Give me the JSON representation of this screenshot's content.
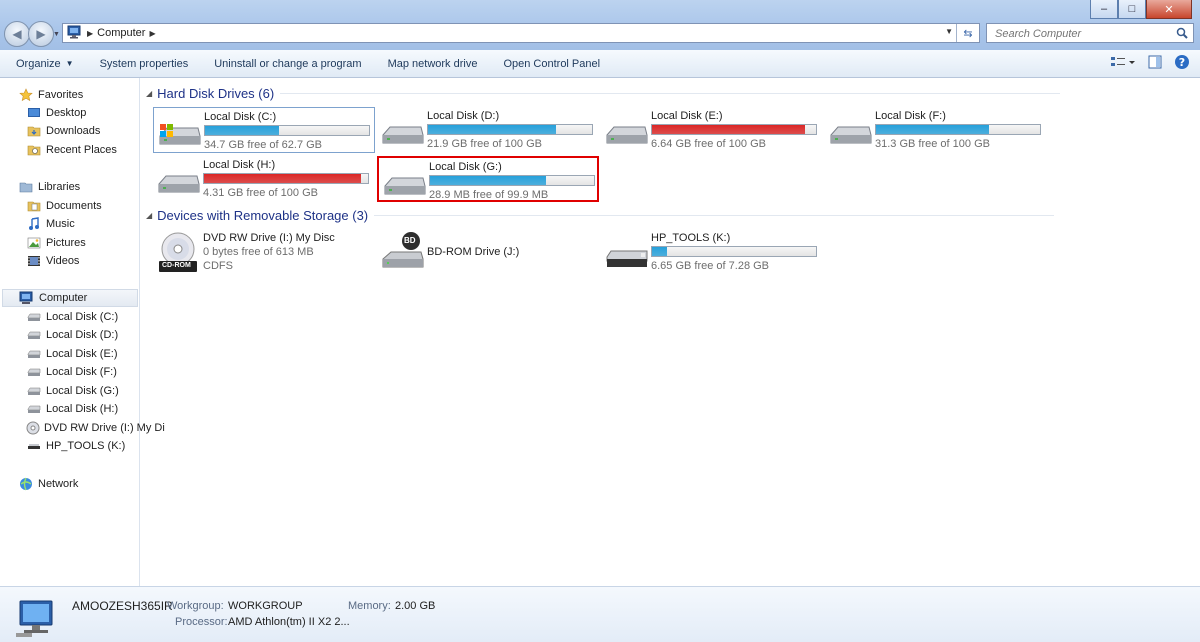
{
  "window": {
    "minimize": "–",
    "maximize": "□",
    "close": "✕"
  },
  "address": {
    "crumb": "Computer"
  },
  "search": {
    "placeholder": "Search Computer"
  },
  "toolbar": {
    "organize": "Organize",
    "system_properties": "System properties",
    "uninstall": "Uninstall or change a program",
    "map_drive": "Map network drive",
    "control_panel": "Open Control Panel"
  },
  "sidebar": {
    "favorites": "Favorites",
    "desktop": "Desktop",
    "downloads": "Downloads",
    "recent": "Recent Places",
    "libraries": "Libraries",
    "documents": "Documents",
    "music": "Music",
    "pictures": "Pictures",
    "videos": "Videos",
    "computer": "Computer",
    "drives": [
      "Local Disk (C:)",
      "Local Disk (D:)",
      "Local Disk (E:)",
      "Local Disk (F:)",
      "Local Disk (G:)",
      "Local Disk (H:)",
      "DVD RW Drive (I:) My Disc",
      "HP_TOOLS (K:)"
    ],
    "network": "Network"
  },
  "groups": {
    "hard_disks": "Hard Disk Drives (6)",
    "removable": "Devices with Removable Storage (3)"
  },
  "hard_disks": [
    {
      "name": "Local Disk (C:)",
      "info": "34.7 GB free of 62.7 GB",
      "used_fraction": 0.45,
      "color": "#26a0da"
    },
    {
      "name": "Local Disk (D:)",
      "info": "21.9 GB free of 100 GB",
      "used_fraction": 0.78,
      "color": "#26a0da"
    },
    {
      "name": "Local Disk (E:)",
      "info": "6.64 GB free of 100 GB",
      "used_fraction": 0.93,
      "color": "#da2626"
    },
    {
      "name": "Local Disk (F:)",
      "info": "31.3 GB free of 100 GB",
      "used_fraction": 0.69,
      "color": "#26a0da"
    },
    {
      "name": "Local Disk (H:)",
      "info": "4.31 GB free of 100 GB",
      "used_fraction": 0.96,
      "color": "#da2626"
    },
    {
      "name": "Local Disk (G:)",
      "info": "28.9 MB free of 99.9 MB",
      "used_fraction": 0.71,
      "color": "#26a0da"
    }
  ],
  "removable": {
    "dvd": {
      "name": "DVD RW Drive (I:) My Disc",
      "info": "0 bytes free of 613 MB",
      "fs": "CDFS",
      "badge": "CD-ROM"
    },
    "bd": {
      "name": "BD-ROM Drive (J:)",
      "badge": "BD"
    },
    "hp": {
      "name": "HP_TOOLS (K:)",
      "info": "6.65 GB free of 7.28 GB",
      "used_fraction": 0.09,
      "color": "#26a0da"
    }
  },
  "details": {
    "name": "AMOOZESH365IR",
    "workgroup_label": "Workgroup:",
    "workgroup": "WORKGROUP",
    "memory_label": "Memory:",
    "memory": "2.00 GB",
    "processor_label": "Processor:",
    "processor": "AMD Athlon(tm) II X2 2..."
  }
}
